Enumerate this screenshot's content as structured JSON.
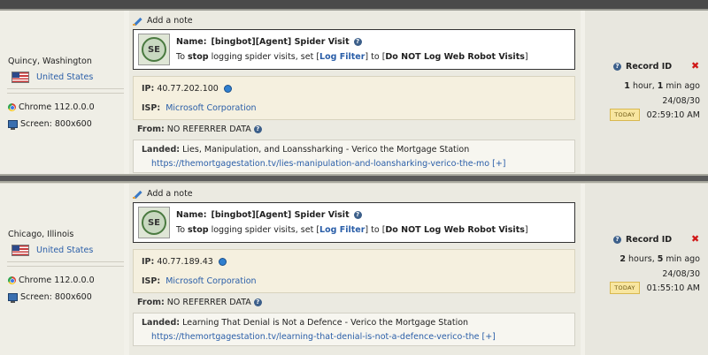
{
  "records": [
    {
      "location": "Quincy, Washington",
      "country": "United States",
      "browser": "Chrome 112.0.0.0",
      "screen": "Screen: 800x600",
      "add_note": "Add a note",
      "name_label": "Name:",
      "name_value": "[bingbot][Agent] Spider Visit",
      "hint_pre": "To ",
      "hint_stop": "stop",
      "hint_mid": " logging spider visits, set [",
      "hint_link": "Log Filter",
      "hint_mid2": "] to [",
      "hint_value": "Do NOT Log Web Robot Visits",
      "hint_end": "]",
      "ip_label": "IP:",
      "ip": "40.77.202.100",
      "isp_label": "ISP:",
      "isp": "Microsoft Corporation",
      "from_label": "From:",
      "from": "NO REFERRER DATA",
      "landed_label": "Landed:",
      "landed_title": "Lies, Manipulation, and Loanssharking - Verico the Mortgage Station",
      "landed_url": "https://themortgagestation.tv/lies-manipulation-and-loansharking-verico-the-mo",
      "expand": "[+]",
      "record_id_label": "Record ID",
      "ago_num1": "1",
      "ago_unit1": " hour, ",
      "ago_num2": "1",
      "ago_unit2": " min ago",
      "date": "24/08/30",
      "today": "TODAY",
      "time": "02:59:10 AM"
    },
    {
      "location": "Chicago, Illinois",
      "country": "United States",
      "browser": "Chrome 112.0.0.0",
      "screen": "Screen: 800x600",
      "add_note": "Add a note",
      "name_label": "Name:",
      "name_value": "[bingbot][Agent] Spider Visit",
      "hint_pre": "To ",
      "hint_stop": "stop",
      "hint_mid": " logging spider visits, set [",
      "hint_link": "Log Filter",
      "hint_mid2": "] to [",
      "hint_value": "Do NOT Log Web Robot Visits",
      "hint_end": "]",
      "ip_label": "IP:",
      "ip": "40.77.189.43",
      "isp_label": "ISP:",
      "isp": "Microsoft Corporation",
      "from_label": "From:",
      "from": "NO REFERRER DATA",
      "landed_label": "Landed:",
      "landed_title": "Learning That Denial is Not a Defence - Verico the Mortgage Station",
      "landed_url": "https://themortgagestation.tv/learning-that-denial-is-not-a-defence-verico-the",
      "expand": "[+]",
      "record_id_label": "Record ID",
      "ago_num1": "2",
      "ago_unit1": " hours, ",
      "ago_num2": "5",
      "ago_unit2": " min ago",
      "date": "24/08/30",
      "today": "TODAY",
      "time": "01:55:10 AM"
    }
  ],
  "icons": {
    "flag": "us-flag-icon",
    "browser": "chrome-icon",
    "screen": "monitor-icon",
    "note": "pencil-icon",
    "avatar": "search-engine-icon",
    "help": "question-icon",
    "lookup": "globe-icon",
    "delete": "close-icon"
  },
  "colors": {
    "link": "#2a5ea8",
    "delete": "#d01818",
    "today_bg": "#f8e6a0"
  }
}
